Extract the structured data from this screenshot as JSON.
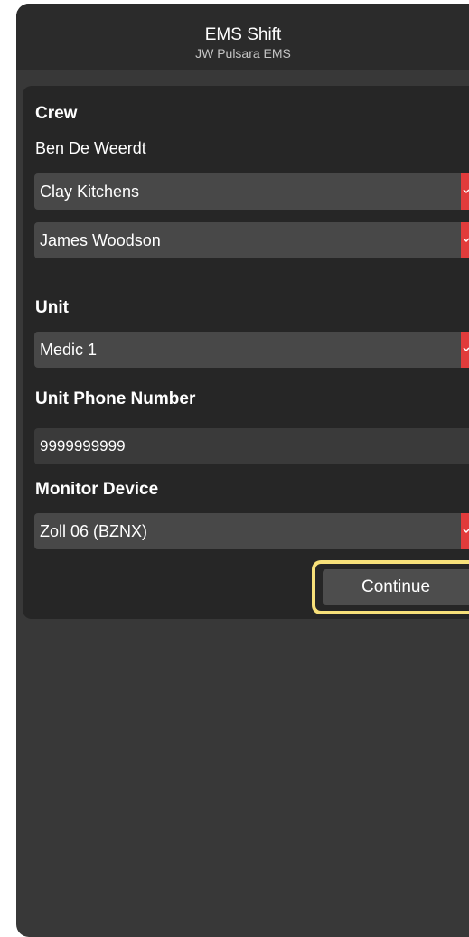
{
  "header": {
    "title": "EMS Shift",
    "subtitle": "JW Pulsara EMS"
  },
  "crew": {
    "label": "Crew",
    "lead_member": "Ben De Weerdt",
    "member_2": "Clay Kitchens",
    "member_3": "James Woodson"
  },
  "unit": {
    "label": "Unit",
    "value": "Medic 1"
  },
  "unit_phone": {
    "label": "Unit Phone Number",
    "value": "9999999999"
  },
  "monitor": {
    "label": "Monitor Device",
    "value": "Zoll 06 (BZNX)"
  },
  "actions": {
    "continue_label": "Continue"
  },
  "colors": {
    "background": "#383838",
    "card": "#262626",
    "field": "#484848",
    "caret_accent": "#e13b3b",
    "focus_ring": "#f7e07a"
  },
  "icons": {
    "dropdown": "chevron-down-icon"
  }
}
